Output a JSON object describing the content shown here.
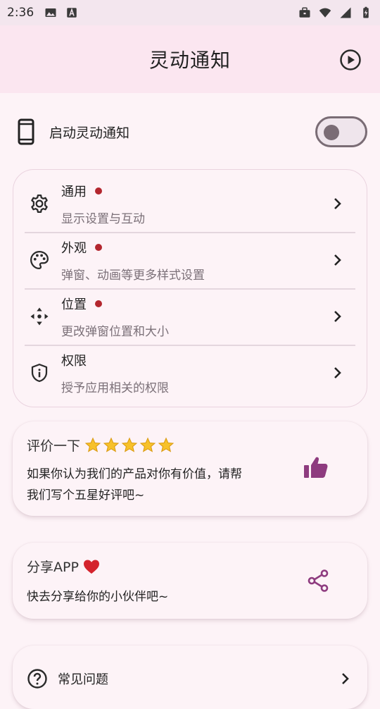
{
  "status": {
    "time": "2:36",
    "left_icons": [
      "image-icon",
      "font-a-icon"
    ],
    "right_icons": [
      "briefcase-icon",
      "wifi-icon",
      "signal-icon",
      "battery-charging-icon"
    ]
  },
  "header": {
    "title": "灵动通知",
    "action_icon": "play-circle-icon"
  },
  "toggle": {
    "icon": "phone-icon",
    "label": "启动灵动通知",
    "enabled": false
  },
  "settings": {
    "items": [
      {
        "icon": "gear-icon",
        "title": "通用",
        "subtitle": "显示设置与互动",
        "has_dot": true
      },
      {
        "icon": "palette-icon",
        "title": "外观",
        "subtitle": "弹窗、动画等更多样式设置",
        "has_dot": true
      },
      {
        "icon": "move-arrows-icon",
        "title": "位置",
        "subtitle": "更改弹窗位置和大小",
        "has_dot": true
      },
      {
        "icon": "shield-icon",
        "title": "权限",
        "subtitle": "授予应用相关的权限",
        "has_dot": false
      }
    ]
  },
  "rate": {
    "title": "评价一下",
    "stars": 5,
    "body_line1": "如果你认为我们的产品对你有价值，请帮",
    "body_line2": "我们写个五星好评吧~",
    "icon": "thumbs-up-icon"
  },
  "share": {
    "title": "分享APP",
    "body": "快去分享给你的小伙伴吧~",
    "icon": "share-icon"
  },
  "faq": {
    "title": "常见问题",
    "icon": "help-circle-icon"
  },
  "colors": {
    "accent": "#8e3b7f",
    "dot": "#b3262e",
    "header_bg": "#fbe6f0",
    "page_bg": "#fdf3f7"
  }
}
